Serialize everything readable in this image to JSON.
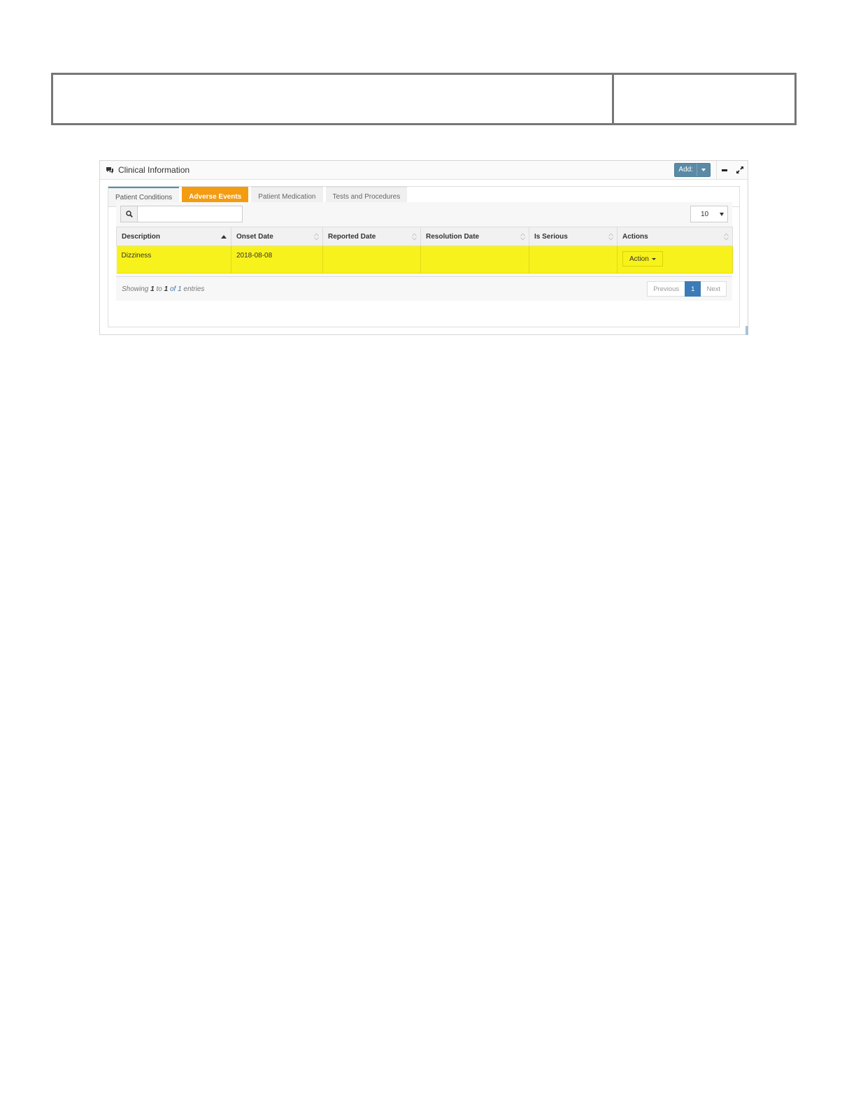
{
  "panel": {
    "title": "Clinical Information",
    "add_label": "Add:",
    "icons": {
      "title": "comments-icon",
      "collapse": "minus-icon",
      "expand": "expand-icon",
      "search": "search-icon"
    }
  },
  "tabs": [
    {
      "label": "Patient Conditions"
    },
    {
      "label": "Adverse Events",
      "active": true
    },
    {
      "label": "Patient Medication"
    },
    {
      "label": "Tests and Procedures"
    }
  ],
  "table": {
    "page_length": "10",
    "columns": [
      "Description",
      "Onset Date",
      "Reported Date",
      "Resolution Date",
      "Is Serious",
      "Actions"
    ],
    "rows": [
      {
        "description": "Dizziness",
        "onset_date": "2018-08-08",
        "reported_date": "",
        "resolution_date": "",
        "is_serious": "",
        "action_label": "Action"
      }
    ],
    "info": {
      "prefix": "Showing",
      "start": "1",
      "to": "to",
      "end": "1",
      "of": "of",
      "total": "1",
      "suffix": "entries"
    },
    "pager": {
      "previous": "Previous",
      "current": "1",
      "next": "Next"
    }
  },
  "colors": {
    "highlight_row": "#f8f21c",
    "active_tab": "#f39c12",
    "add_button": "#5b8aa6",
    "current_page": "#3a7bb8"
  }
}
